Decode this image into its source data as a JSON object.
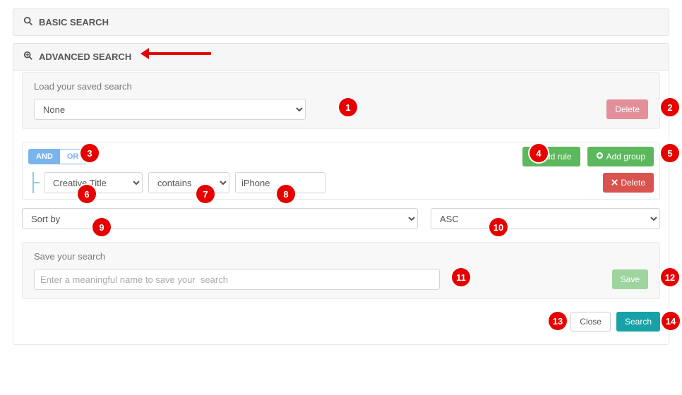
{
  "modal": {
    "close_icon": "×"
  },
  "basic": {
    "title": "BASIC SEARCH"
  },
  "advanced": {
    "title": "ADVANCED SEARCH"
  },
  "load": {
    "label": "Load your saved search",
    "selected": "None",
    "delete_label": "Delete"
  },
  "query": {
    "and_label": "AND",
    "or_label": "OR",
    "add_rule_label": "Add rule",
    "add_group_label": "Add group",
    "rule": {
      "field": "Creative Title",
      "operator": "contains",
      "value": "iPhone",
      "delete_label": "Delete"
    }
  },
  "sort": {
    "placeholder": "Sort by",
    "direction": "ASC"
  },
  "save": {
    "label": "Save your search",
    "placeholder": "Enter a meaningful name to save your  search",
    "button_label": "Save"
  },
  "footer": {
    "close_label": "Close",
    "search_label": "Search"
  },
  "badges": [
    "1",
    "2",
    "3",
    "4",
    "5",
    "6",
    "7",
    "8",
    "9",
    "10",
    "11",
    "12",
    "13",
    "14"
  ]
}
